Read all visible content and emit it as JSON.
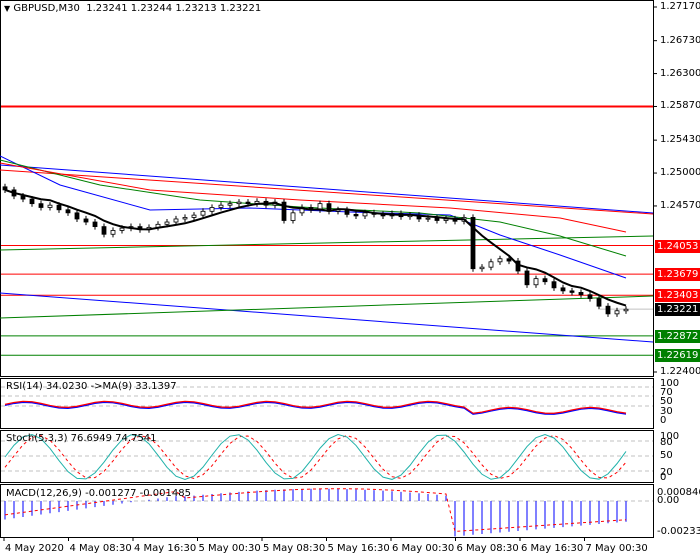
{
  "header": {
    "arrow": "▼",
    "symbol": "GBPUSD,M30",
    "ohlc": "1.23241 1.23244 1.23213 1.23221"
  },
  "price_axis": [
    "1.27170",
    "1.26730",
    "1.26300",
    "1.25870",
    "1.25430",
    "1.25000",
    "1.24570",
    "1.22400"
  ],
  "price_tags": [
    {
      "text": "1.24053",
      "value": 1.24053,
      "color": "#ff0000"
    },
    {
      "text": "1.23679",
      "value": 1.23679,
      "color": "#ff0000"
    },
    {
      "text": "1.23403",
      "value": 1.23403,
      "color": "#ff0000"
    },
    {
      "text": "1.23221",
      "value": 1.23221,
      "color": "#000000"
    },
    {
      "text": "1.22872",
      "value": 1.22872,
      "color": "#008000"
    },
    {
      "text": "1.22619",
      "value": 1.22619,
      "color": "#008000"
    }
  ],
  "rsi": {
    "label": "RSI(14) 34.0230  ->MA(9) 33.1397",
    "ticks": [
      "100",
      "70",
      "50",
      "30",
      "0"
    ]
  },
  "stoch": {
    "label": "Stoch(5,3,3) 76.6949 74.7541",
    "ticks": [
      "100",
      "80",
      "50",
      "20",
      "0"
    ]
  },
  "macd": {
    "label": "MACD(12,26,9) -0.001277 -0.001485",
    "ticks": [
      "0.000846",
      "0.00",
      "-0.002332"
    ]
  },
  "time_axis": [
    "4 May 2020",
    "4 May 08:30",
    "4 May 16:30",
    "5 May 00:30",
    "5 May 08:30",
    "5 May 16:30",
    "6 May 00:30",
    "6 May 08:30",
    "6 May 16:30",
    "7 May 00:30"
  ],
  "chart_data": {
    "type": "candlestick",
    "title": "GBPUSD,M30",
    "ylim": [
      1.224,
      1.2717
    ],
    "horizontal_levels": [
      1.2587,
      1.24053,
      1.23679,
      1.23403,
      1.22872,
      1.22619
    ],
    "closes": [
      1.2478,
      1.247,
      1.2466,
      1.246,
      1.2455,
      1.2458,
      1.2452,
      1.2448,
      1.244,
      1.2436,
      1.243,
      1.242,
      1.2425,
      1.2428,
      1.243,
      1.2426,
      1.2429,
      1.2433,
      1.2436,
      1.244,
      1.2442,
      1.2445,
      1.245,
      1.2455,
      1.2458,
      1.246,
      1.2462,
      1.246,
      1.2463,
      1.2458,
      1.2462,
      1.2438,
      1.2448,
      1.2455,
      1.2452,
      1.246,
      1.245,
      1.2452,
      1.2446,
      1.2444,
      1.2448,
      1.2446,
      1.2444,
      1.2447,
      1.2443,
      1.2445,
      1.244,
      1.2441,
      1.2438,
      1.244,
      1.2437,
      1.2442,
      1.2375,
      1.2377,
      1.2384,
      1.2388,
      1.2385,
      1.2372,
      1.2354,
      1.2362,
      1.2358,
      1.235,
      1.2346,
      1.2344,
      1.2341,
      1.2336,
      1.2326,
      1.2316,
      1.232,
      1.2322
    ]
  }
}
